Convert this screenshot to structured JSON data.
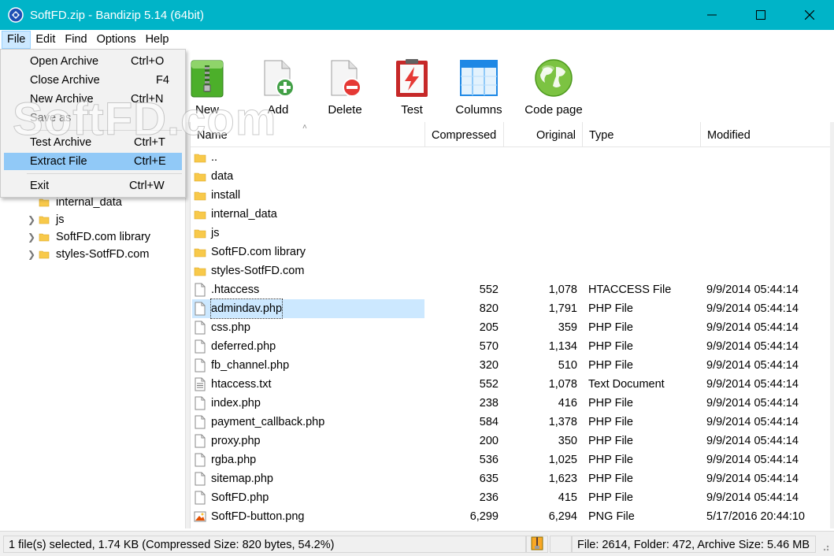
{
  "window": {
    "title": "SoftFD.zip - Bandizip 5.14 (64bit)",
    "minimize_glyph": "—",
    "maximize_glyph": "☐",
    "close_glyph": "✕"
  },
  "menu": [
    "File",
    "Edit",
    "Find",
    "Options",
    "Help"
  ],
  "file_menu": {
    "items": [
      {
        "label": "Open Archive",
        "shortcut": "Ctrl+O"
      },
      {
        "label": "Close Archive",
        "shortcut": "F4"
      },
      {
        "label": "New Archive",
        "shortcut": "Ctrl+N"
      },
      {
        "label": "Save as",
        "shortcut": ""
      },
      {
        "label": "Test Archive",
        "shortcut": "Ctrl+T"
      },
      {
        "label": "Extract File",
        "shortcut": "Ctrl+E"
      },
      {
        "label": "Exit",
        "shortcut": "Ctrl+W"
      }
    ]
  },
  "toolbar": [
    {
      "label": "New",
      "icon": "zip-archive-icon"
    },
    {
      "label": "Add",
      "icon": "add-file-icon"
    },
    {
      "label": "Delete",
      "icon": "delete-file-icon"
    },
    {
      "label": "Test",
      "icon": "test-lightning-icon"
    },
    {
      "label": "Columns",
      "icon": "columns-icon"
    },
    {
      "label": "Code page",
      "icon": "globe-icon"
    }
  ],
  "tree": [
    {
      "label": "internal_data",
      "expandable": false
    },
    {
      "label": "js",
      "expandable": true
    },
    {
      "label": "SoftFD.com library",
      "expandable": true
    },
    {
      "label": "styles-SotfFD.com",
      "expandable": true
    }
  ],
  "columns": [
    "Name",
    "Compressed",
    "Original",
    "Type",
    "Modified"
  ],
  "rows": [
    {
      "name": "..",
      "kind": "folder",
      "compressed": "",
      "original": "",
      "type": "",
      "modified": ""
    },
    {
      "name": "data",
      "kind": "folder",
      "compressed": "",
      "original": "",
      "type": "",
      "modified": ""
    },
    {
      "name": "install",
      "kind": "folder",
      "compressed": "",
      "original": "",
      "type": "",
      "modified": ""
    },
    {
      "name": "internal_data",
      "kind": "folder",
      "compressed": "",
      "original": "",
      "type": "",
      "modified": ""
    },
    {
      "name": "js",
      "kind": "folder",
      "compressed": "",
      "original": "",
      "type": "",
      "modified": ""
    },
    {
      "name": "SoftFD.com library",
      "kind": "folder",
      "compressed": "",
      "original": "",
      "type": "",
      "modified": ""
    },
    {
      "name": "styles-SotfFD.com",
      "kind": "folder",
      "compressed": "",
      "original": "",
      "type": "",
      "modified": ""
    },
    {
      "name": ".htaccess",
      "kind": "file",
      "compressed": "552",
      "original": "1,078",
      "type": "HTACCESS File",
      "modified": "9/9/2014 05:44:14"
    },
    {
      "name": "admindav.php",
      "kind": "file",
      "compressed": "820",
      "original": "1,791",
      "type": "PHP File",
      "modified": "9/9/2014 05:44:14",
      "selected": true
    },
    {
      "name": "css.php",
      "kind": "file",
      "compressed": "205",
      "original": "359",
      "type": "PHP File",
      "modified": "9/9/2014 05:44:14"
    },
    {
      "name": "deferred.php",
      "kind": "file",
      "compressed": "570",
      "original": "1,134",
      "type": "PHP File",
      "modified": "9/9/2014 05:44:14"
    },
    {
      "name": "fb_channel.php",
      "kind": "file",
      "compressed": "320",
      "original": "510",
      "type": "PHP File",
      "modified": "9/9/2014 05:44:14"
    },
    {
      "name": "htaccess.txt",
      "kind": "text",
      "compressed": "552",
      "original": "1,078",
      "type": "Text Document",
      "modified": "9/9/2014 05:44:14"
    },
    {
      "name": "index.php",
      "kind": "file",
      "compressed": "238",
      "original": "416",
      "type": "PHP File",
      "modified": "9/9/2014 05:44:14"
    },
    {
      "name": "payment_callback.php",
      "kind": "file",
      "compressed": "584",
      "original": "1,378",
      "type": "PHP File",
      "modified": "9/9/2014 05:44:14"
    },
    {
      "name": "proxy.php",
      "kind": "file",
      "compressed": "200",
      "original": "350",
      "type": "PHP File",
      "modified": "9/9/2014 05:44:14"
    },
    {
      "name": "rgba.php",
      "kind": "file",
      "compressed": "536",
      "original": "1,025",
      "type": "PHP File",
      "modified": "9/9/2014 05:44:14"
    },
    {
      "name": "sitemap.php",
      "kind": "file",
      "compressed": "635",
      "original": "1,623",
      "type": "PHP File",
      "modified": "9/9/2014 05:44:14"
    },
    {
      "name": "SoftFD.php",
      "kind": "file",
      "compressed": "236",
      "original": "415",
      "type": "PHP File",
      "modified": "9/9/2014 05:44:14"
    },
    {
      "name": "SoftFD-button.png",
      "kind": "image",
      "compressed": "6,299",
      "original": "6,294",
      "type": "PNG File",
      "modified": "5/17/2016 20:44:10"
    }
  ],
  "status": {
    "selection": "1 file(s) selected, 1.74 KB (Compressed Size: 820 bytes, 54.2%)",
    "summary": "File: 2614, Folder: 472, Archive Size: 5.46 MB"
  },
  "watermark": "SoftFD.com",
  "colors": {
    "titlebar": "#00b4c8",
    "selection": "#cce8ff",
    "menu_highlight": "#91c9f7",
    "folder": "#f8c94a"
  }
}
